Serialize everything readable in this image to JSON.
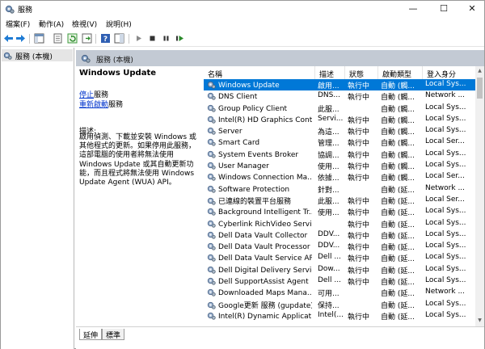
{
  "window": {
    "title": "服務",
    "minimize": "—",
    "maximize": "☐",
    "close": "✕"
  },
  "menu": [
    "檔案(F)",
    "動作(A)",
    "檢視(V)",
    "說明(H)"
  ],
  "tree": {
    "item": "服務 (本機)"
  },
  "pane": {
    "header": "服務 (本機)"
  },
  "desc": {
    "title": "Windows Update",
    "stop_link": "停止",
    "stop_suffix": "服務",
    "restart_link": "重新啟動",
    "restart_suffix": "服務",
    "label": "描述:",
    "body": "啟用偵測、下載並安裝 Windows 或其他程式的更新。如果停用此服務，這部電腦的使用者將無法使用 Windows Update 或其自動更新功能，而且程式將無法使用 Windows Update Agent (WUA) API。"
  },
  "columns": {
    "name": "名稱",
    "desc": "描述",
    "status": "狀態",
    "startup": "啟動類型",
    "logon": "登入身分"
  },
  "rows": [
    {
      "name": "Windows Update",
      "desc": "啟用...",
      "status": "執行中",
      "startup": "自動 (觸...",
      "logon": "Local Sys..."
    },
    {
      "name": "DNS Client",
      "desc": "DNS...",
      "status": "執行中",
      "startup": "自動 (觸...",
      "logon": "Network ..."
    },
    {
      "name": "Group Policy Client",
      "desc": "此服...",
      "status": "",
      "startup": "自動 (觸...",
      "logon": "Local Sys..."
    },
    {
      "name": "Intel(R) HD Graphics Contr...",
      "desc": "Servi...",
      "status": "執行中",
      "startup": "自動 (觸...",
      "logon": "Local Sys..."
    },
    {
      "name": "Server",
      "desc": "為這...",
      "status": "執行中",
      "startup": "自動 (觸...",
      "logon": "Local Sys..."
    },
    {
      "name": "Smart Card",
      "desc": "管理...",
      "status": "執行中",
      "startup": "自動 (觸...",
      "logon": "Local Ser..."
    },
    {
      "name": "System Events Broker",
      "desc": "協調...",
      "status": "執行中",
      "startup": "自動 (觸...",
      "logon": "Local Sys..."
    },
    {
      "name": "User Manager",
      "desc": "使用...",
      "status": "執行中",
      "startup": "自動 (觸...",
      "logon": "Local Sys..."
    },
    {
      "name": "Windows Connection Ma...",
      "desc": "依據...",
      "status": "執行中",
      "startup": "自動 (觸...",
      "logon": "Local Ser..."
    },
    {
      "name": "Software Protection",
      "desc": "針對...",
      "status": "",
      "startup": "自動 (延...",
      "logon": "Network ..."
    },
    {
      "name": "已連線的裝置平台服務",
      "desc": "此服...",
      "status": "執行中",
      "startup": "自動 (延...",
      "logon": "Local Ser..."
    },
    {
      "name": "Background Intelligent Tr...",
      "desc": "使用...",
      "status": "執行中",
      "startup": "自動 (延...",
      "logon": "Local Sys..."
    },
    {
      "name": "Cyberlink RichVideo Servi...",
      "desc": "",
      "status": "執行中",
      "startup": "自動 (延...",
      "logon": "Local Sys..."
    },
    {
      "name": "Dell Data Vault Collector",
      "desc": "DDV...",
      "status": "執行中",
      "startup": "自動 (延...",
      "logon": "Local Sys..."
    },
    {
      "name": "Dell Data Vault Processor",
      "desc": "DDV...",
      "status": "執行中",
      "startup": "自動 (延...",
      "logon": "Local Sys..."
    },
    {
      "name": "Dell Data Vault Service API",
      "desc": "Dell ...",
      "status": "執行中",
      "startup": "自動 (延...",
      "logon": "Local Sys..."
    },
    {
      "name": "Dell Digital Delivery Service",
      "desc": "Dow...",
      "status": "執行中",
      "startup": "自動 (延...",
      "logon": "Local Sys..."
    },
    {
      "name": "Dell SupportAssist Agent",
      "desc": "Dell ...",
      "status": "執行中",
      "startup": "自動 (延...",
      "logon": "Local Sys..."
    },
    {
      "name": "Downloaded Maps Mana...",
      "desc": "可用...",
      "status": "",
      "startup": "自動 (延...",
      "logon": "Network ..."
    },
    {
      "name": "Google更新 服務 (gupdate)",
      "desc": "保持...",
      "status": "",
      "startup": "自動 (延...",
      "logon": "Local Sys..."
    },
    {
      "name": "Intel(R) Dynamic Applicati...",
      "desc": "Intel(...",
      "status": "執行中",
      "startup": "自動 (延...",
      "logon": "Local Sys..."
    }
  ],
  "tabs": [
    "延伸",
    "標準"
  ],
  "colors": {
    "selection": "#0078d7",
    "pane_header": "#c3cad4",
    "link": "#0033cc"
  }
}
